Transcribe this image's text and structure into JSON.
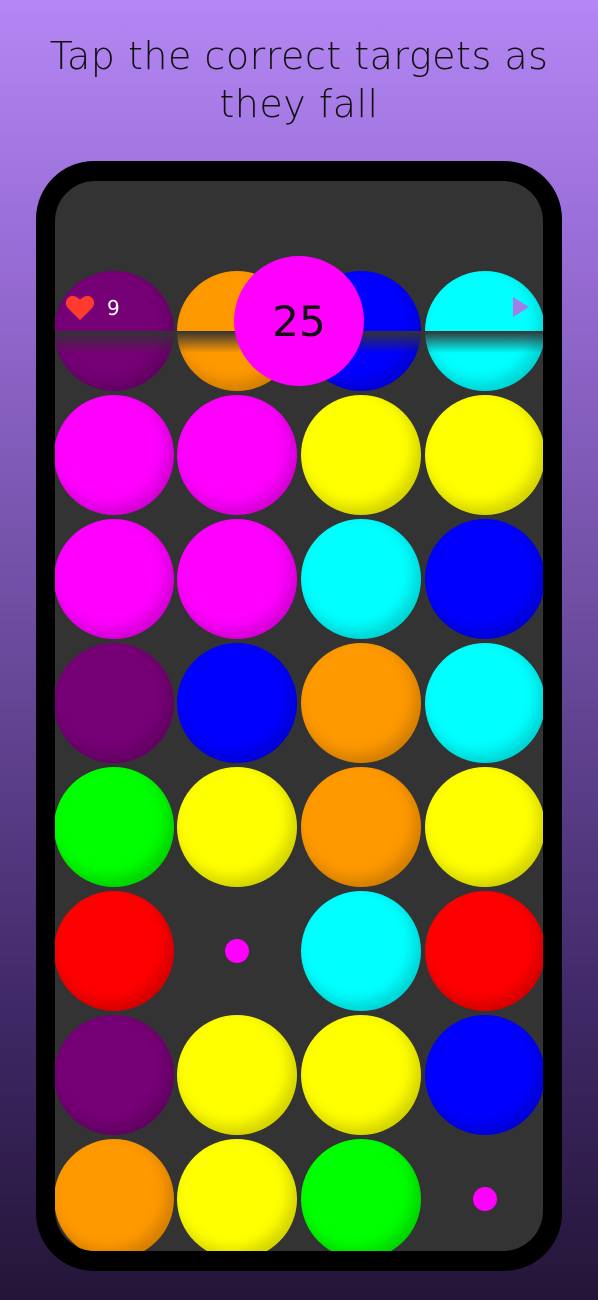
{
  "caption": "Tap the correct targets as they fall",
  "hud": {
    "lives": "9",
    "score": "25",
    "heart_icon": "heart-icon",
    "play_icon": "play-icon"
  },
  "colors": {
    "purple": "#760076",
    "orange": "#ff9900",
    "blue": "#0000ff",
    "cyan": "#00ffff",
    "magenta": "#ff00ff",
    "yellow": "#ffff00",
    "green": "#00ff00",
    "red": "#ff0000",
    "heart": "#ff3b30",
    "play": "#a27ee6"
  },
  "grid": [
    [
      "purple",
      "orange",
      "blue",
      "cyan"
    ],
    [
      "magenta",
      "magenta",
      "yellow",
      "yellow"
    ],
    [
      "magenta",
      "magenta",
      "cyan",
      "blue"
    ],
    [
      "purple",
      "blue",
      "orange",
      "cyan"
    ],
    [
      "green",
      "yellow",
      "orange",
      "yellow"
    ],
    [
      "red",
      null,
      "cyan",
      "red"
    ],
    [
      "purple",
      "yellow",
      "yellow",
      "blue"
    ],
    [
      "orange",
      "yellow",
      "green",
      null
    ]
  ],
  "small_targets": [
    {
      "row": 5,
      "col": 1,
      "color": "magenta"
    },
    {
      "row": 7,
      "col": 3,
      "color": "magenta"
    }
  ]
}
